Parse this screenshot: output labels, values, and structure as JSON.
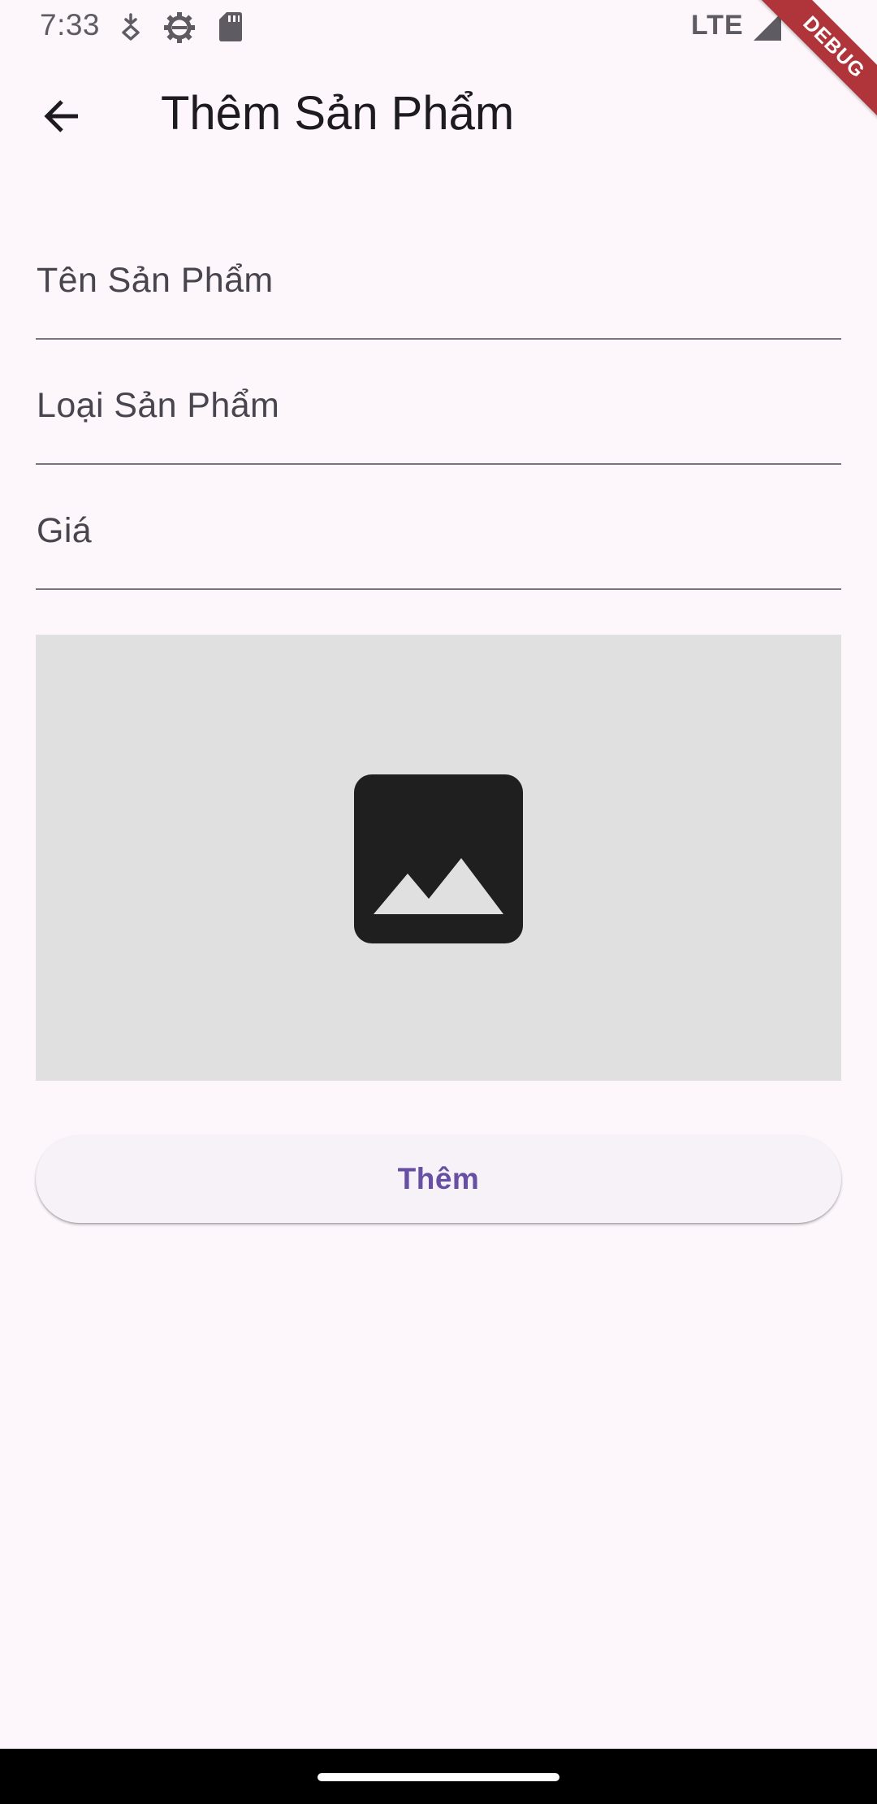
{
  "status_bar": {
    "time": "7:33",
    "icons": [
      "data-saver-icon",
      "gear-icon",
      "sd-card-icon"
    ],
    "network": "LTE",
    "signal_icon": "cell-signal-icon"
  },
  "debug_banner": "DEBUG",
  "app_bar": {
    "back_icon": "arrow-back-icon",
    "title": "Thêm Sản Phẩm"
  },
  "form": {
    "fields": [
      {
        "label": "Tên Sản Phẩm",
        "value": ""
      },
      {
        "label": "Loại Sản Phẩm",
        "value": ""
      },
      {
        "label": "Giá",
        "value": ""
      }
    ],
    "image_picker": {
      "icon": "image-icon"
    },
    "submit_label": "Thêm"
  },
  "colors": {
    "background": "#fdf7fc",
    "accent": "#6750a4",
    "image_placeholder": "#e0e0e0",
    "debug_ribbon": "#b0353a"
  }
}
